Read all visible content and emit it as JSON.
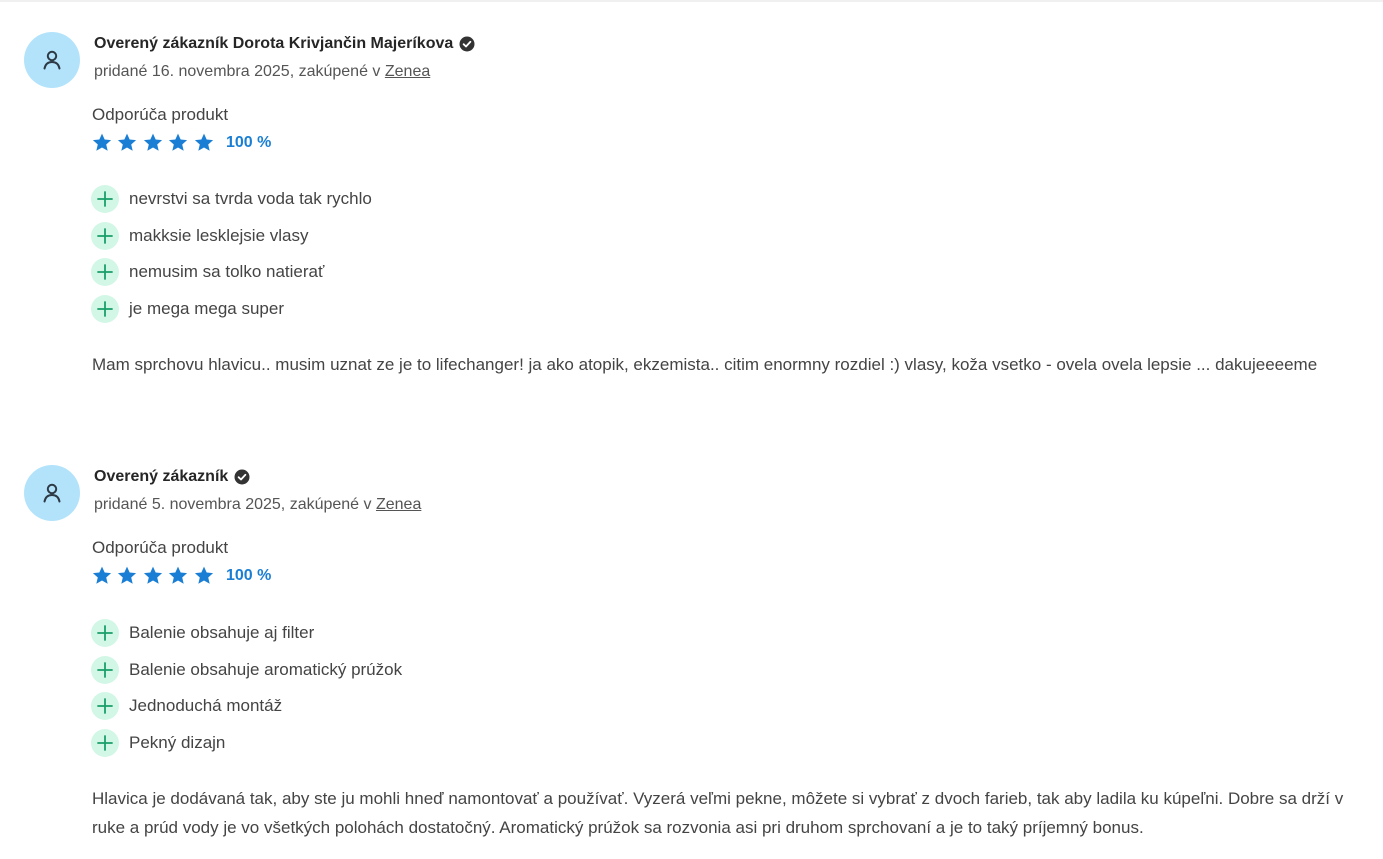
{
  "reviews": [
    {
      "author": "Overený zákazník Dorota Krivjančin Majeríkova",
      "added_prefix": "pridané 16. novembra 2025, zakúpené v ",
      "store": "Zenea",
      "recommends": "Odporúča produkt",
      "rating_percent": "100 %",
      "stars": 5,
      "pros": [
        "nevrstvi sa tvrda voda tak rychlo",
        "makksie lesklejsie vlasy",
        "nemusim sa tolko natierať",
        "je mega mega super"
      ],
      "text": "Mam sprchovu hlavicu.. musim uznat ze je to lifechanger! ja ako atopik, ekzemista.. citim enormny rozdiel :) vlasy, koža vsetko - ovela ovela lepsie ... dakujeeeeme"
    },
    {
      "author": "Overený zákazník",
      "added_prefix": "pridané 5. novembra 2025, zakúpené v ",
      "store": "Zenea",
      "recommends": "Odporúča produkt",
      "rating_percent": "100 %",
      "stars": 5,
      "pros": [
        "Balenie obsahuje aj filter",
        "Balenie obsahuje aromatický prúžok",
        "Jednoduchá montáž",
        "Pekný dizajn"
      ],
      "text": "Hlavica je dodávaná tak, aby ste ju mohli hneď namontovať a používať. Vyzerá veľmi pekne, môžete si vybrať z dvoch farieb, tak aby ladila ku kúpeľni. Dobre sa drží v ruke a prúd vody je vo všetkých polohách dostatočný. Aromatický prúžok sa rozvonia asi pri druhom sprchovaní a je to taký príjemný bonus."
    }
  ],
  "colors": {
    "accent": "#1a7fd4",
    "avatar_bg": "#b3e3fb",
    "pro_bg": "#d2f7e6",
    "pro_icon": "#1a9e6a"
  },
  "icons": {
    "avatar": "user-icon",
    "verified": "verified-check-icon",
    "star": "star-icon",
    "pro": "plus-icon"
  }
}
